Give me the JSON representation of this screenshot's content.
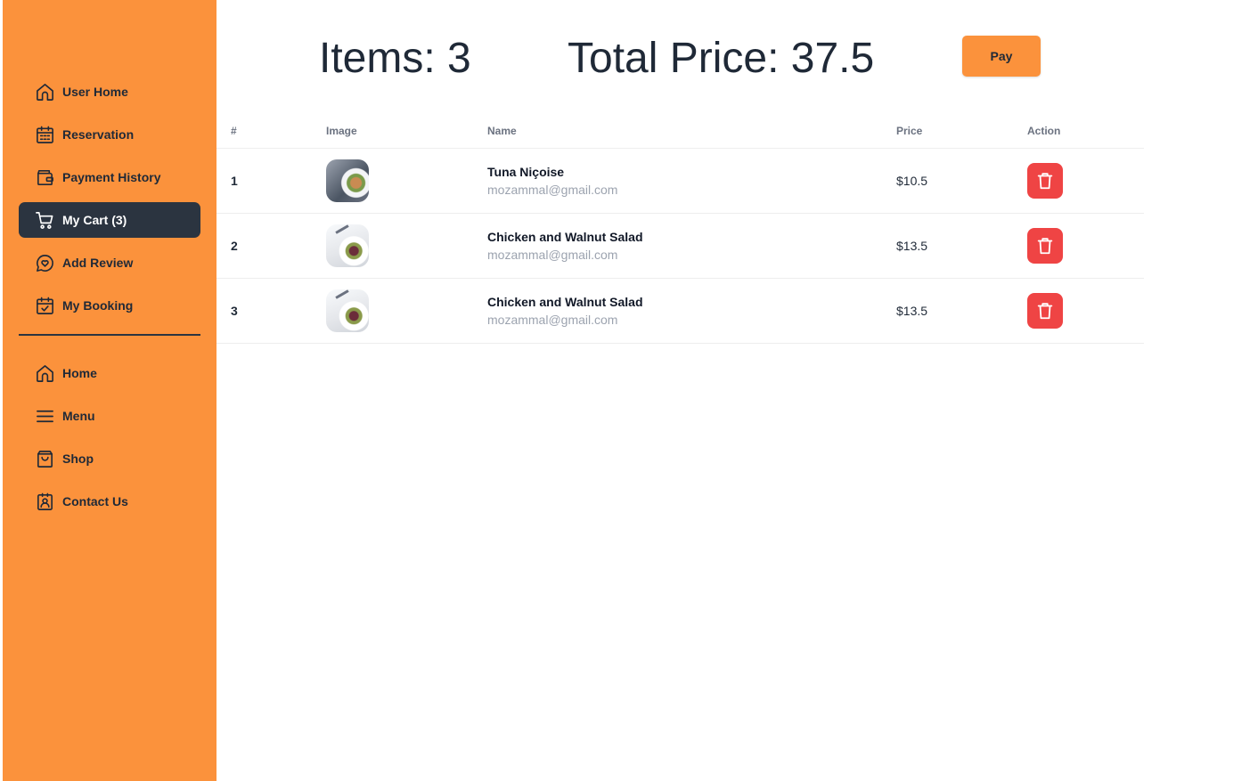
{
  "sidebar": {
    "primary": [
      {
        "label": "User Home",
        "icon": "home-icon",
        "active": false
      },
      {
        "label": "Reservation",
        "icon": "calendar-icon",
        "active": false
      },
      {
        "label": "Payment History",
        "icon": "wallet-icon",
        "active": false
      },
      {
        "label": "My Cart (3)",
        "icon": "cart-icon",
        "active": true
      },
      {
        "label": "Add Review",
        "icon": "review-icon",
        "active": false
      },
      {
        "label": "My Booking",
        "icon": "calendar-check-icon",
        "active": false
      }
    ],
    "secondary": [
      {
        "label": "Home",
        "icon": "home-icon"
      },
      {
        "label": "Menu",
        "icon": "menu-icon"
      },
      {
        "label": "Shop",
        "icon": "shopping-bag-icon"
      },
      {
        "label": "Contact Us",
        "icon": "contact-badge-icon"
      }
    ]
  },
  "summary": {
    "items_label": "Items: 3",
    "total_label": "Total Price: 37.5",
    "pay_label": "Pay"
  },
  "table": {
    "headers": {
      "num": "#",
      "image": "Image",
      "name": "Name",
      "price": "Price",
      "action": "Action"
    },
    "rows": [
      {
        "num": "1",
        "name": "Tuna Niçoise",
        "email": "mozammal@gmail.com",
        "price": "$10.5",
        "image": "tuna-nicoise-photo"
      },
      {
        "num": "2",
        "name": "Chicken and Walnut Salad",
        "email": "mozammal@gmail.com",
        "price": "$13.5",
        "image": "chicken-walnut-salad-photo"
      },
      {
        "num": "3",
        "name": "Chicken and Walnut Salad",
        "email": "mozammal@gmail.com",
        "price": "$13.5",
        "image": "chicken-walnut-salad-photo"
      }
    ]
  },
  "colors": {
    "sidebar_bg": "#fb923c",
    "active_item_bg": "#2b3440",
    "delete_button": "#ef4444",
    "pay_button": "#fb923c"
  }
}
